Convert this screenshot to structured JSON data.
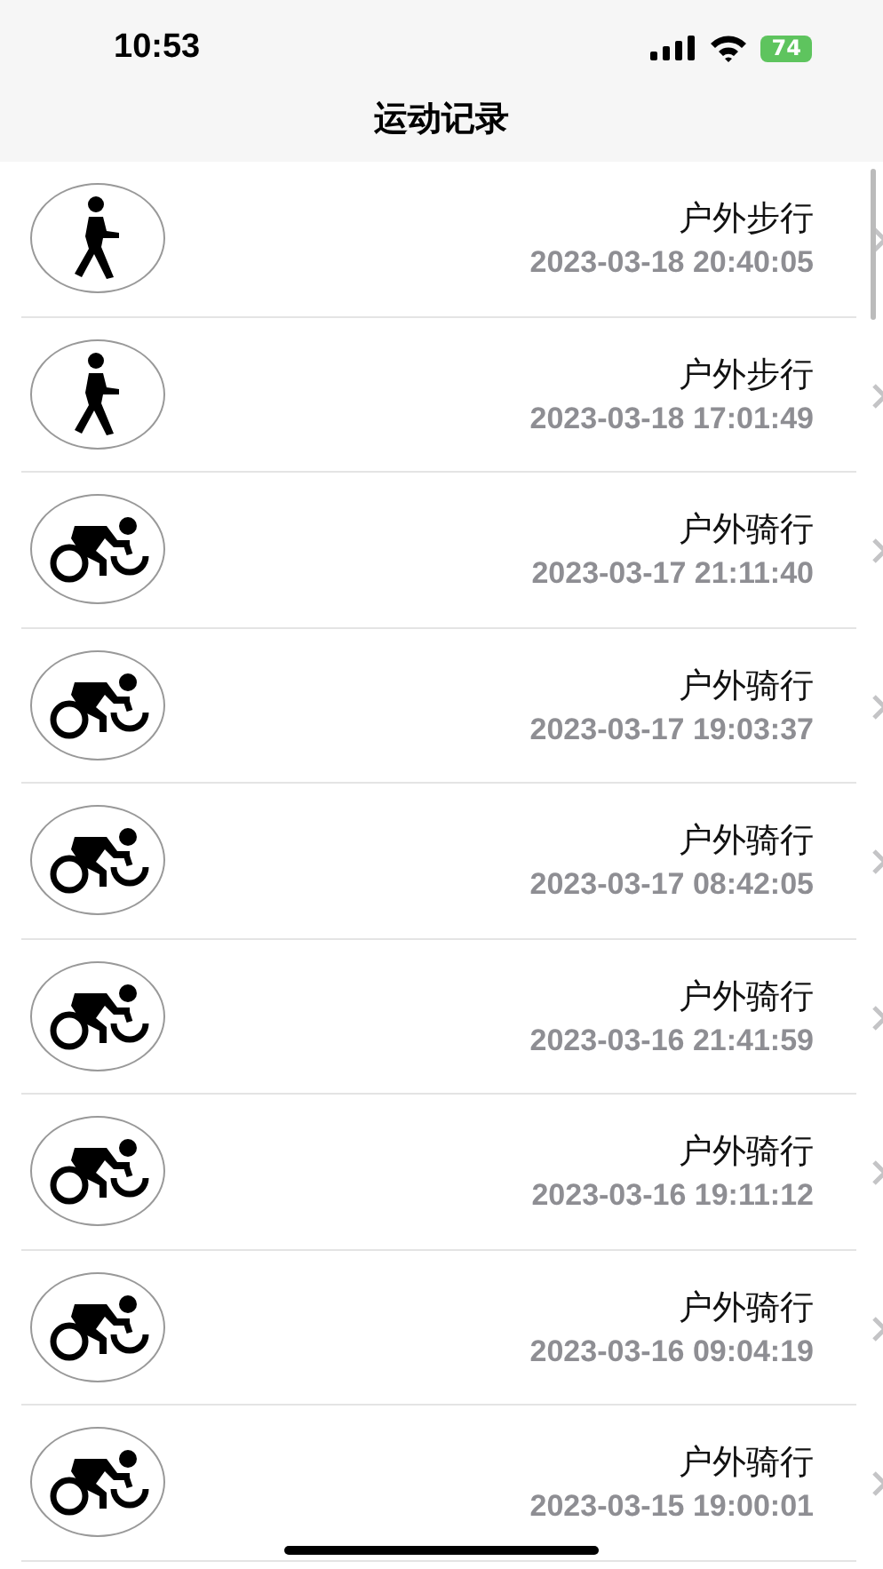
{
  "status_bar": {
    "time": "10:53",
    "battery": "74"
  },
  "nav_bar": {
    "title": "运动记录"
  },
  "records": [
    {
      "kind": "walk",
      "title": "户外步行",
      "time": "2023-03-18 20:40:05"
    },
    {
      "kind": "walk",
      "title": "户外步行",
      "time": "2023-03-18 17:01:49"
    },
    {
      "kind": "cycle",
      "title": "户外骑行",
      "time": "2023-03-17 21:11:40"
    },
    {
      "kind": "cycle",
      "title": "户外骑行",
      "time": "2023-03-17 19:03:37"
    },
    {
      "kind": "cycle",
      "title": "户外骑行",
      "time": "2023-03-17 08:42:05"
    },
    {
      "kind": "cycle",
      "title": "户外骑行",
      "time": "2023-03-16 21:41:59"
    },
    {
      "kind": "cycle",
      "title": "户外骑行",
      "time": "2023-03-16 19:11:12"
    },
    {
      "kind": "cycle",
      "title": "户外骑行",
      "time": "2023-03-16 09:04:19"
    },
    {
      "kind": "cycle",
      "title": "户外骑行",
      "time": "2023-03-15 19:00:01"
    }
  ]
}
